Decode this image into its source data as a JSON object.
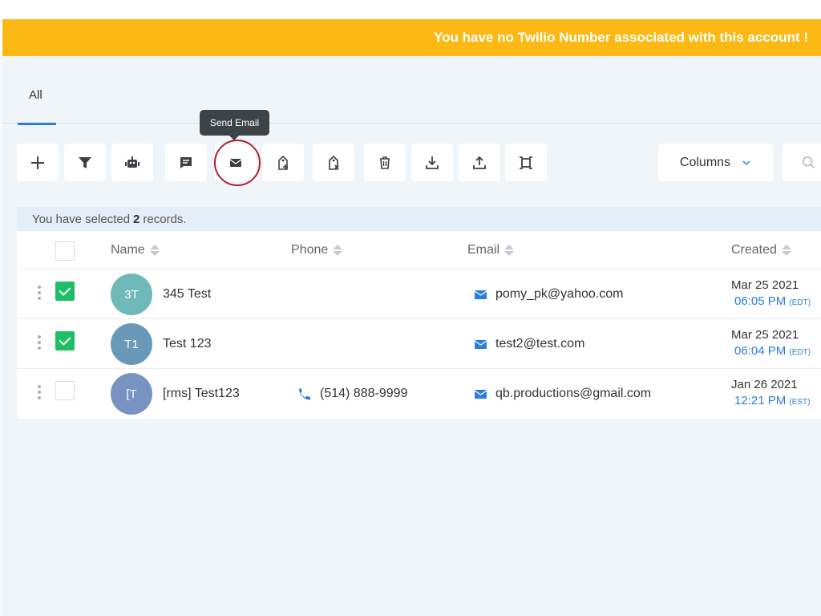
{
  "banner": {
    "message": "You have no Twilio Number associated with this account !"
  },
  "tabs": [
    {
      "label": "All",
      "active": true
    }
  ],
  "tooltip": {
    "text": "Send Email"
  },
  "toolbar": {
    "buttons": [
      {
        "name": "add",
        "icon": "plus-icon"
      },
      {
        "name": "filter",
        "icon": "filter-icon"
      },
      {
        "name": "automation",
        "icon": "robot-icon"
      },
      {
        "name": "send-sms",
        "icon": "message-icon"
      },
      {
        "name": "send-email",
        "icon": "envelope-icon",
        "highlighted": true
      },
      {
        "name": "add-tag",
        "icon": "tag-add-icon"
      },
      {
        "name": "remove-tag",
        "icon": "tag-remove-icon"
      },
      {
        "name": "delete",
        "icon": "trash-icon"
      },
      {
        "name": "import",
        "icon": "download-icon"
      },
      {
        "name": "export",
        "icon": "upload-icon"
      },
      {
        "name": "merge",
        "icon": "merge-icon"
      }
    ],
    "columns_label": "Columns"
  },
  "selection": {
    "prefix": "You have selected",
    "count": "2",
    "suffix": "records."
  },
  "table": {
    "headers": {
      "name": "Name",
      "phone": "Phone",
      "email": "Email",
      "created": "Created"
    },
    "rows": [
      {
        "checked": true,
        "initials": "3T",
        "avatar_color": "#6fb9b9",
        "name": "345 Test",
        "phone": "",
        "email": "pomy_pk@yahoo.com",
        "date": "Mar 25 2021",
        "time": "06:05 PM",
        "tz": "(EDT)"
      },
      {
        "checked": true,
        "initials": "T1",
        "avatar_color": "#6a98b8",
        "name": "Test 123",
        "phone": "",
        "email": "test2@test.com",
        "date": "Mar 25 2021",
        "time": "06:04 PM",
        "tz": "(EDT)"
      },
      {
        "checked": false,
        "initials": "[T",
        "avatar_color": "#7893c1",
        "name": "[rms] Test123",
        "phone": "(514) 888-9999",
        "email": "qb.productions@gmail.com",
        "date": "Jan 26 2021",
        "time": "12:21 PM",
        "tz": "(EST)"
      }
    ]
  },
  "colors": {
    "banner": "#fdb913",
    "accent": "#2b7de0",
    "checked": "#1fbf67",
    "highlight_ring": "#b0202e"
  }
}
